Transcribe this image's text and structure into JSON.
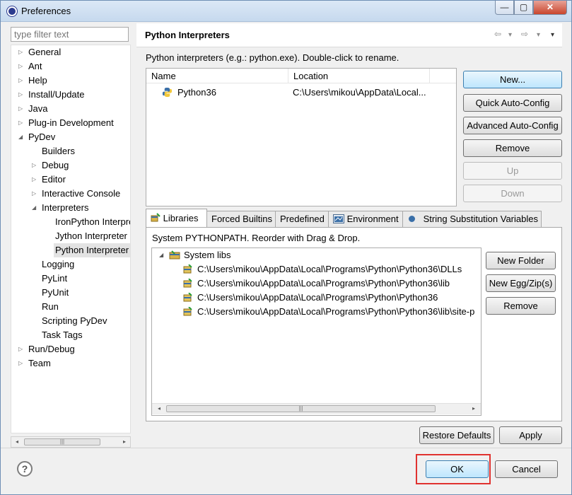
{
  "window": {
    "title": "Preferences",
    "min_label": "—",
    "max_label": "▢",
    "close_label": "✕"
  },
  "filter": {
    "placeholder": "type filter text"
  },
  "tree": {
    "items": [
      {
        "label": "General",
        "twisty": "▷"
      },
      {
        "label": "Ant",
        "twisty": "▷"
      },
      {
        "label": "Help",
        "twisty": "▷"
      },
      {
        "label": "Install/Update",
        "twisty": "▷"
      },
      {
        "label": "Java",
        "twisty": "▷"
      },
      {
        "label": "Plug-in Development",
        "twisty": "▷"
      },
      {
        "label": "PyDev",
        "twisty": "◢"
      },
      {
        "label": "Builders"
      },
      {
        "label": "Debug",
        "twisty": "▷"
      },
      {
        "label": "Editor",
        "twisty": "▷"
      },
      {
        "label": "Interactive Console",
        "twisty": "▷"
      },
      {
        "label": "Interpreters",
        "twisty": "◢"
      },
      {
        "label": "IronPython Interpre"
      },
      {
        "label": "Jython Interpreter"
      },
      {
        "label": "Python Interpreter"
      },
      {
        "label": "Logging"
      },
      {
        "label": "PyLint"
      },
      {
        "label": "PyUnit"
      },
      {
        "label": "Run"
      },
      {
        "label": "Scripting PyDev"
      },
      {
        "label": "Task Tags"
      },
      {
        "label": "Run/Debug",
        "twisty": "▷"
      },
      {
        "label": "Team",
        "twisty": "▷"
      }
    ]
  },
  "page": {
    "title": "Python Interpreters",
    "description": "Python interpreters (e.g.: python.exe).   Double-click to rename.",
    "nav": {
      "back": "⇦",
      "back_menu": "▾",
      "forward": "⇨",
      "forward_menu": "▾",
      "view_menu": "▾"
    }
  },
  "interpreters": {
    "columns": [
      "Name",
      "Location"
    ],
    "rows": [
      {
        "name": "Python36",
        "location": "C:\\Users\\mikou\\AppData\\Local..."
      }
    ]
  },
  "side_buttons": {
    "new": "New...",
    "quick": "Quick Auto-Config",
    "advanced": "Advanced Auto-Config",
    "remove": "Remove",
    "up": "Up",
    "down": "Down"
  },
  "tabs": [
    {
      "label": "Libraries"
    },
    {
      "label": "Forced Builtins"
    },
    {
      "label": "Predefined"
    },
    {
      "label": "Environment"
    },
    {
      "label": "String Substitution Variables"
    }
  ],
  "libraries": {
    "hint": "System PYTHONPATH.   Reorder with Drag & Drop.",
    "root": "System libs",
    "paths": [
      "C:\\Users\\mikou\\AppData\\Local\\Programs\\Python\\Python36\\DLLs",
      "C:\\Users\\mikou\\AppData\\Local\\Programs\\Python\\Python36\\lib",
      "C:\\Users\\mikou\\AppData\\Local\\Programs\\Python\\Python36",
      "C:\\Users\\mikou\\AppData\\Local\\Programs\\Python\\Python36\\lib\\site-p"
    ],
    "new_folder": "New Folder",
    "new_egg": "New Egg/Zip(s)",
    "remove": "Remove"
  },
  "footer": {
    "restore": "Restore Defaults",
    "apply": "Apply",
    "ok": "OK",
    "cancel": "Cancel",
    "help": "?"
  },
  "scroll": {
    "left": "◂",
    "right": "▸",
    "grip": "|||"
  },
  "colors": {
    "highlight": "#e0322f",
    "selection": "#e3e3e3"
  }
}
